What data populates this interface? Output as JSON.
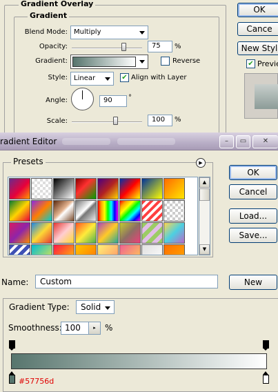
{
  "layer_style": {
    "gradient_overlay_title": "Gradient Overlay",
    "gradient_section_title": "Gradient",
    "blend_mode": {
      "label": "Blend Mode:",
      "value": "Multiply"
    },
    "opacity": {
      "label": "Opacity:",
      "value": "75",
      "unit": "%",
      "level": 0.75
    },
    "gradient": {
      "label": "Gradient:",
      "reverse_label": "Reverse",
      "reverse_checked": false
    },
    "style": {
      "label": "Style:",
      "value": "Linear",
      "align_label": "Align with Layer",
      "align_checked": true
    },
    "angle": {
      "label": "Angle:",
      "value": "90",
      "unit": "°"
    },
    "scale": {
      "label": "Scale:",
      "value": "100",
      "unit": "%",
      "level": 0.667
    },
    "buttons": {
      "ok": "OK",
      "cancel": "Cance",
      "new_style": "New Styl",
      "preview": "Previe"
    },
    "preview_checked": true
  },
  "gradient_editor": {
    "title": "radient Editor",
    "ghost_buttons": [
      "",
      ""
    ],
    "caption_buttons": {
      "minimize": "–",
      "restore": "▭",
      "close": "✕"
    },
    "presets_label": "Presets",
    "menu_icon": "▶",
    "buttons": {
      "ok": "OK",
      "cancel": "Cancel",
      "load": "Load...",
      "save": "Save...",
      "new": "New"
    },
    "name_label": "Name:",
    "name_value": "Custom",
    "gradient_type_label": "Gradient Type:",
    "gradient_type_value": "Solid",
    "smoothness_label": "Smoothness:",
    "smoothness_value": "100",
    "smoothness_unit": "%",
    "color_stop_hex": "#57756d",
    "gradient_colors": [
      "#57756d",
      "#ffffff"
    ]
  },
  "colors": {
    "dialog_bg": "#ece9d8",
    "xp_border": "#003c74",
    "stop_label": "#e00000"
  },
  "swatches": [
    [
      "linear-gradient(135deg,#6a2b8c,#e8003a 55%,#ff9a00)",
      "repeating-conic-gradient(#ddd 0 25%,#fff 0 50%) 0 0/8px 8px",
      "linear-gradient(135deg,#000,#fff)",
      "linear-gradient(135deg,#8b0000,#ff3030 40%,#00a000)",
      "linear-gradient(135deg,#4b0082,#b22222 50%,#ffd700)",
      "linear-gradient(135deg,#0033aa,#ff0000 50%,#ffff00)",
      "linear-gradient(135deg,#003399,#ffff00)",
      "linear-gradient(135deg,#ff6a00,#ffe600)"
    ],
    [
      "linear-gradient(135deg,#0b7a2f,#ffd400 50%,#e8003a)",
      "linear-gradient(135deg,#8a2be2,#ff7f00 50%,#00ced1)",
      "linear-gradient(135deg,#5b2a0e,#e3b38f 45%,#fff 55%,#7a4a2a)",
      "linear-gradient(135deg,#777,#fff 45%,#777 55%,#eee)",
      "linear-gradient(90deg,red,orange,yellow,lime,cyan,blue,magenta)",
      "linear-gradient(135deg,red,orange,yellow,lime,cyan,blue,magenta)",
      "repeating-linear-gradient(135deg,#ff4040 0 4px,#fff 4px 8px)",
      "repeating-conic-gradient(#ccc 0 25%,#fff 0 50%) 0 0/8px 8px"
    ],
    [
      "linear-gradient(135deg,#d81b60,#8e24aa 50%,#fb8c00)",
      "linear-gradient(135deg,#1e88e5,#fdd835 50%,#e53935)",
      "linear-gradient(135deg,#e53935,#ffcdd2 50%,#fdd835)",
      "linear-gradient(135deg,#ff5722,#ffeb3b 50%,#4caf50)",
      "linear-gradient(135deg,#ab47bc,#ffca28 50%,#26a69a)",
      "linear-gradient(135deg,#c0ca33,#8d6e63 50%,#ec407a)",
      "repeating-linear-gradient(135deg,#9ccc65 0 6px,#e1bee7 6px 12px)",
      "linear-gradient(135deg,#ffd54f,#4dd0e1 50%,#ba68c8)"
    ],
    [
      "repeating-linear-gradient(135deg,#3f51b5 0 5px,#fff 5px 9px)",
      "linear-gradient(135deg,#00bcd4,#ffeb3b)",
      "linear-gradient(135deg,#ff1744,#ffd600)",
      "linear-gradient(135deg,#ffc400,#ff6d00)",
      "linear-gradient(135deg,#fff176,#ff8a65)",
      "linear-gradient(135deg,#f06292,#ffd54f)",
      "linear-gradient(135deg,#e0e0e0,#fff)",
      "linear-gradient(135deg,#ff6f00,#ffab00)"
    ]
  ]
}
